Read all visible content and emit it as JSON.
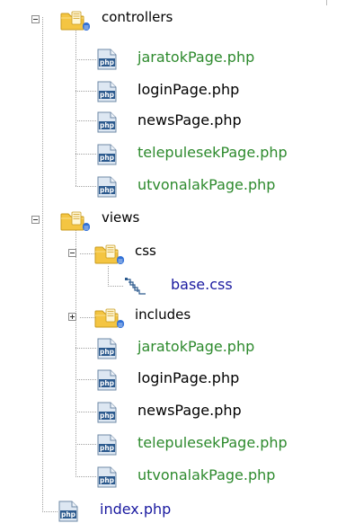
{
  "tree": {
    "controllers": {
      "label": "controllers",
      "files": [
        "jaratokPage.php",
        "loginPage.php",
        "newsPage.php",
        "telepulesekPage.php",
        "utvonalakPage.php"
      ]
    },
    "views": {
      "label": "views",
      "css": {
        "label": "css",
        "files": [
          "base.css"
        ]
      },
      "includes": {
        "label": "includes"
      },
      "files": [
        "jaratokPage.php",
        "loginPage.php",
        "newsPage.php",
        "telepulesekPage.php",
        "utvonalakPage.php"
      ]
    },
    "root_files": [
      "index.php"
    ]
  },
  "icons": {
    "php_badge": "php",
    "expander_expanded": "−",
    "expander_collapsed": "+"
  },
  "colors": {
    "modified_file": "#2d8a2d",
    "normal_file": "#000000",
    "added_file": "#1a1aa0",
    "folder": "#f2c24a"
  }
}
